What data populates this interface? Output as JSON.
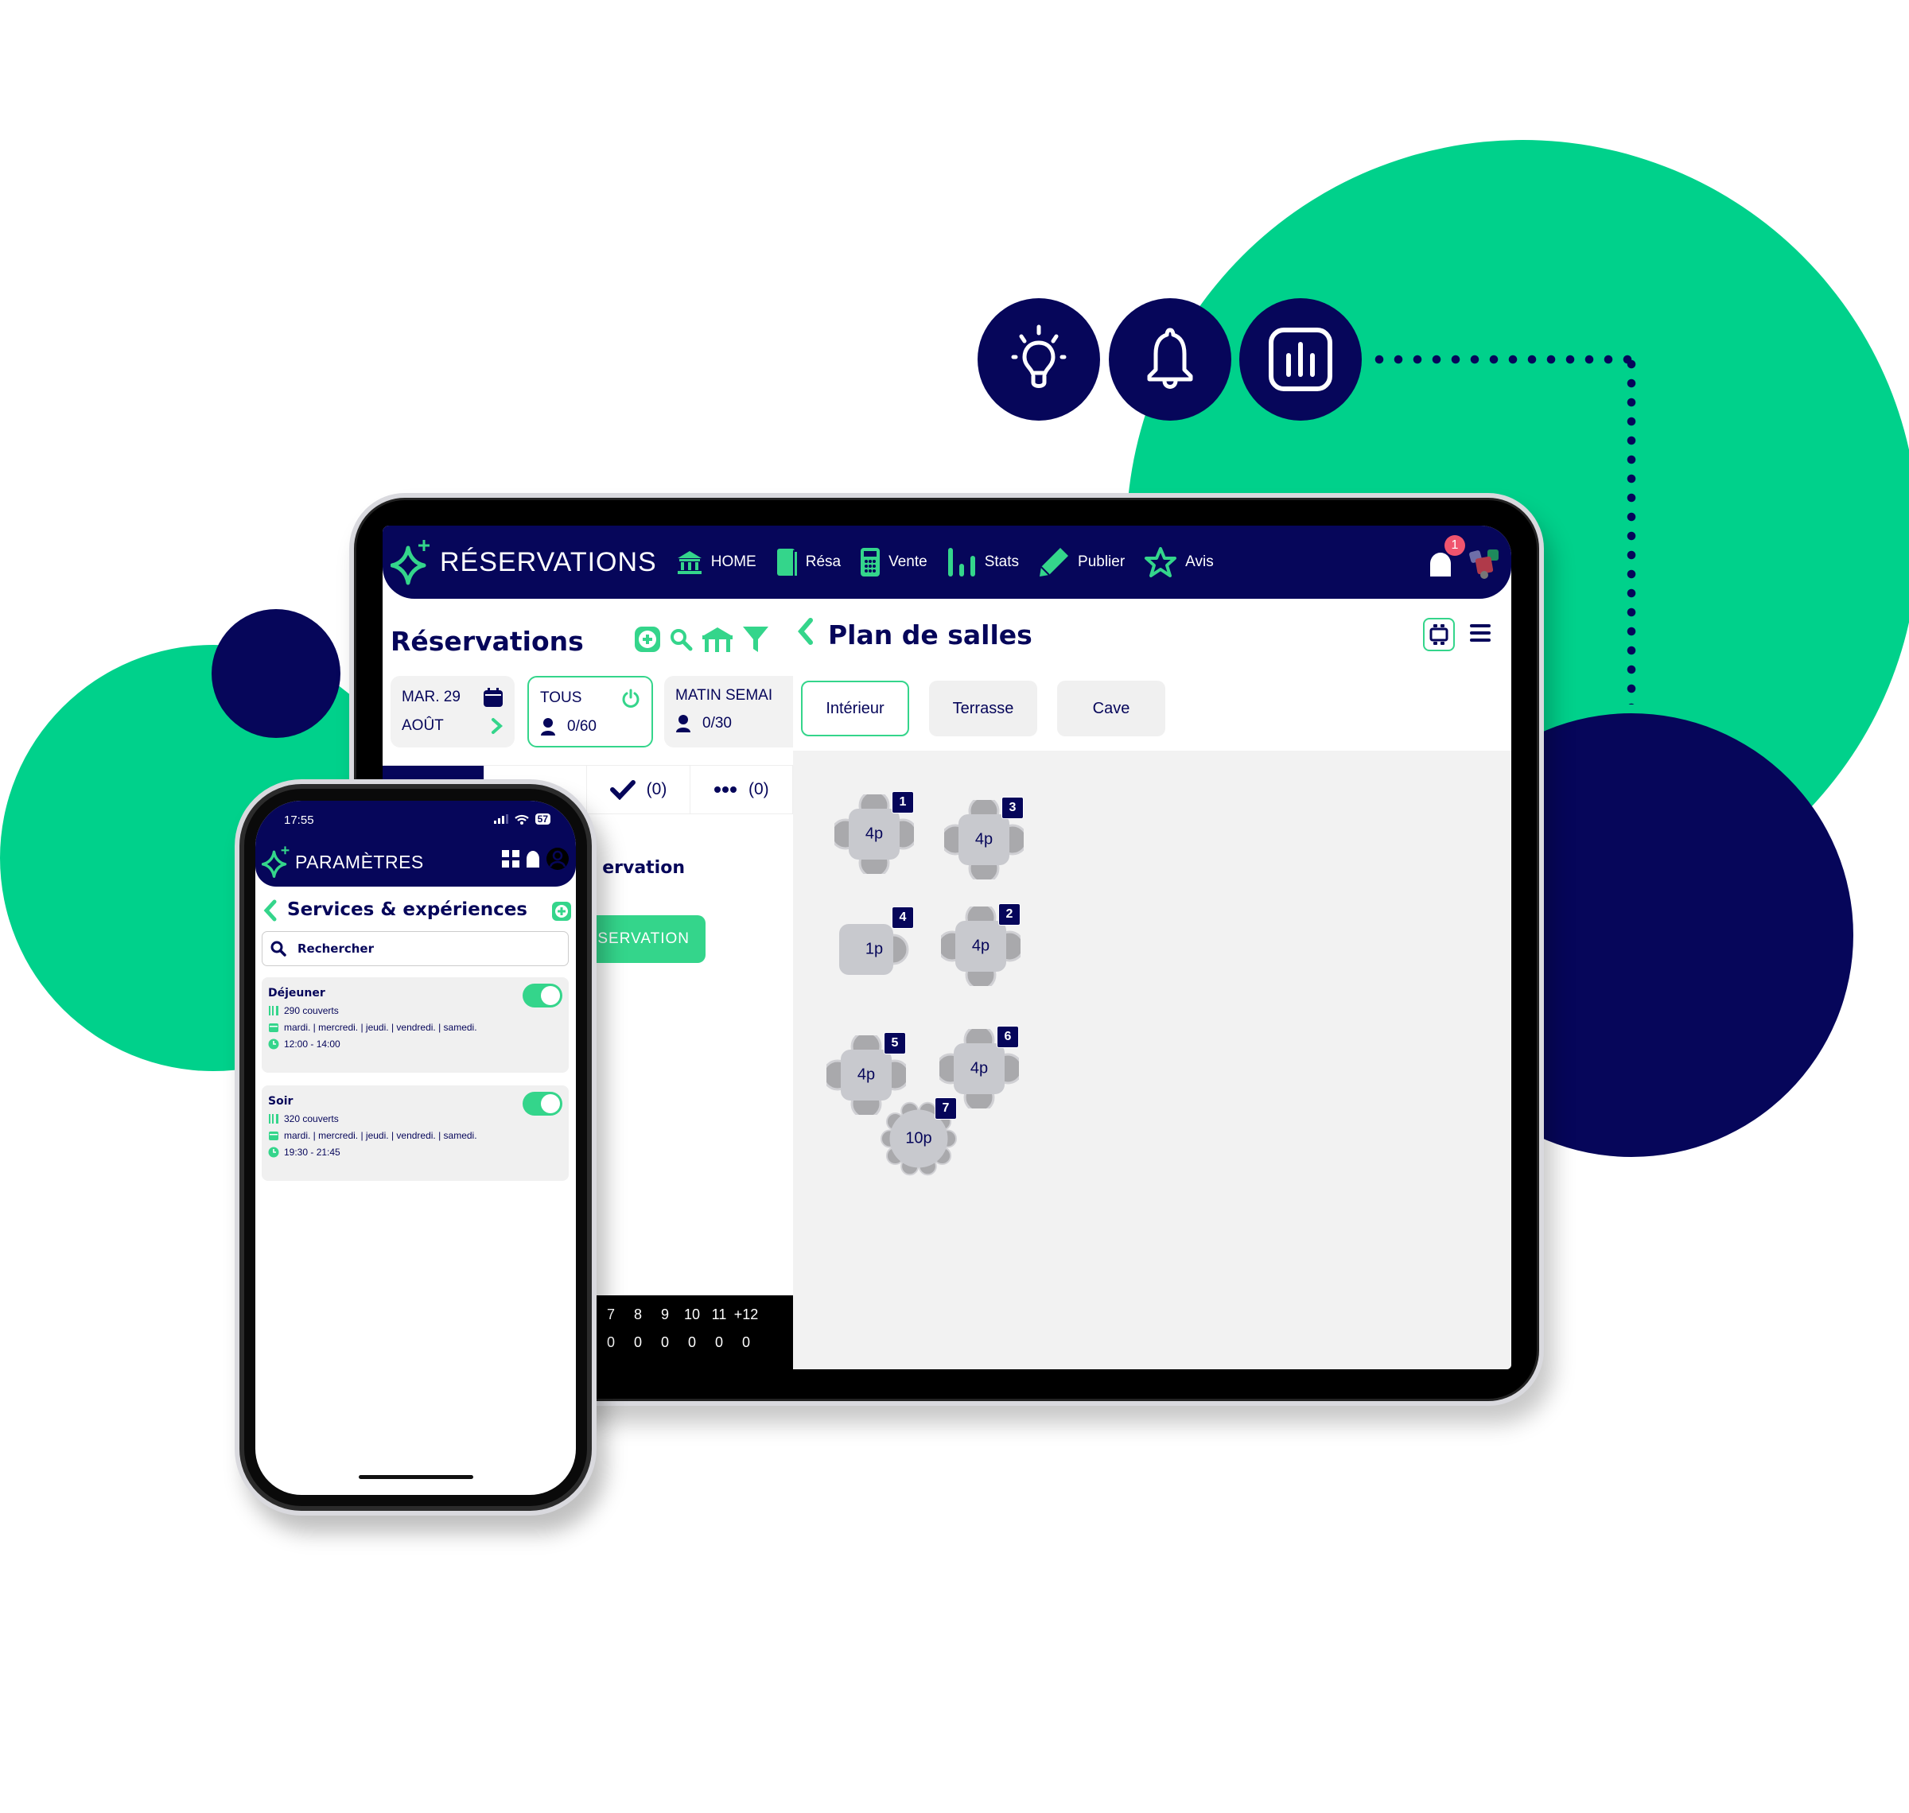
{
  "colors": {
    "brand_navy": "#06065a",
    "brand_green": "#00d18b",
    "accent_green": "#34d58b",
    "badge_red": "#f0546e"
  },
  "feature_icons": [
    "lightbulb-icon",
    "bell-icon",
    "stats-chart-icon"
  ],
  "tablet": {
    "app_title": "RÉSERVATIONS",
    "nav": [
      {
        "label": "HOME",
        "icon": "bank-icon"
      },
      {
        "label": "Résa",
        "icon": "book-icon"
      },
      {
        "label": "Vente",
        "icon": "calculator-icon"
      },
      {
        "label": "Stats",
        "icon": "bar-chart-icon"
      },
      {
        "label": "Publier",
        "icon": "pencil-icon"
      },
      {
        "label": "Avis",
        "icon": "star-icon"
      }
    ],
    "notification_count": "1",
    "left": {
      "title": "Réservations",
      "tools": [
        "add-icon",
        "search-icon",
        "table-icon",
        "filter-icon"
      ],
      "date_card": {
        "day": "MAR. 29",
        "month": "AOÛT"
      },
      "service_cards": [
        {
          "label": "TOUS",
          "count": "0/60",
          "active": true
        },
        {
          "label": "MATIN SEMAI",
          "count": "0/30",
          "active": false
        }
      ],
      "tabs": [
        {
          "icon": "check-icon",
          "count": "(0)"
        },
        {
          "icon": "more-icon",
          "count": "(0)"
        }
      ],
      "empty_text": "ervation",
      "new_button": "SERVATION",
      "hours": [
        "7",
        "8",
        "9",
        "10",
        "11",
        "+12"
      ],
      "hour_counts": [
        "0",
        "0",
        "0",
        "0",
        "0",
        "0"
      ]
    },
    "right": {
      "title": "Plan de salles",
      "rooms": [
        {
          "label": "Intérieur",
          "active": true
        },
        {
          "label": "Terrasse",
          "active": false
        },
        {
          "label": "Cave",
          "active": false
        }
      ],
      "tables": [
        {
          "number": "1",
          "label": "4p",
          "seats": 4
        },
        {
          "number": "3",
          "label": "4p",
          "seats": 4
        },
        {
          "number": "4",
          "label": "1p",
          "seats": 1
        },
        {
          "number": "2",
          "label": "4p",
          "seats": 4
        },
        {
          "number": "5",
          "label": "4p",
          "seats": 4
        },
        {
          "number": "6",
          "label": "4p",
          "seats": 4
        },
        {
          "number": "7",
          "label": "10p",
          "seats": 10
        }
      ]
    }
  },
  "phone": {
    "time": "17:55",
    "battery": "57",
    "app_title": "PARAMÈTRES",
    "page_title": "Services & expériences",
    "search_placeholder": "Rechercher",
    "services": [
      {
        "name": "Déjeuner",
        "covers": "290 couverts",
        "days": "mardi. | mercredi. | jeudi. | vendredi. | samedi.",
        "hours": "12:00 - 14:00",
        "enabled": true
      },
      {
        "name": "Soir",
        "covers": "320 couverts",
        "days": "mardi. | mercredi. | jeudi. | vendredi. | samedi.",
        "hours": "19:30 - 21:45",
        "enabled": true
      }
    ]
  }
}
